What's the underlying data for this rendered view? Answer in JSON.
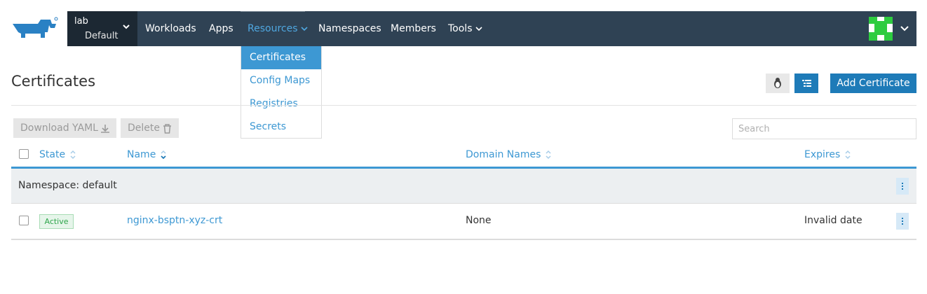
{
  "brand": {
    "logo_icon": "rancher-logo-icon"
  },
  "topbar": {
    "cluster": {
      "name": "lab",
      "project": "Default"
    },
    "nav": [
      {
        "label": "Workloads"
      },
      {
        "label": "Apps"
      },
      {
        "label": "Resources"
      },
      {
        "label": "Namespaces"
      },
      {
        "label": "Members"
      },
      {
        "label": "Tools"
      }
    ],
    "active_nav": "Resources",
    "colors": {
      "bar": "#2f4254",
      "cluster_bg": "#1c2833",
      "active": "#4fa7e0"
    }
  },
  "resources_menu": {
    "items": [
      {
        "label": "Certificates"
      },
      {
        "label": "Config Maps"
      },
      {
        "label": "Registries"
      },
      {
        "label": "Secrets"
      }
    ],
    "selected": "Certificates"
  },
  "header": {
    "title": "Certificates",
    "buttons": {
      "add": "Add Certificate"
    }
  },
  "actions": {
    "download_yaml": "Download YAML",
    "delete": "Delete"
  },
  "search": {
    "placeholder": "Search",
    "value": ""
  },
  "table": {
    "columns": [
      {
        "label": "State"
      },
      {
        "label": "Name"
      },
      {
        "label": "Domain Names"
      },
      {
        "label": "Expires"
      }
    ],
    "group": {
      "label": "Namespace: default"
    },
    "rows": [
      {
        "state": "Active",
        "name": "nginx-bsptn-xyz-crt",
        "domain_names": "None",
        "expires": "Invalid date"
      }
    ]
  },
  "colors": {
    "accent": "#3d98d3",
    "primary_button": "#1e7bb8",
    "active_badge": "#2ea54b"
  }
}
